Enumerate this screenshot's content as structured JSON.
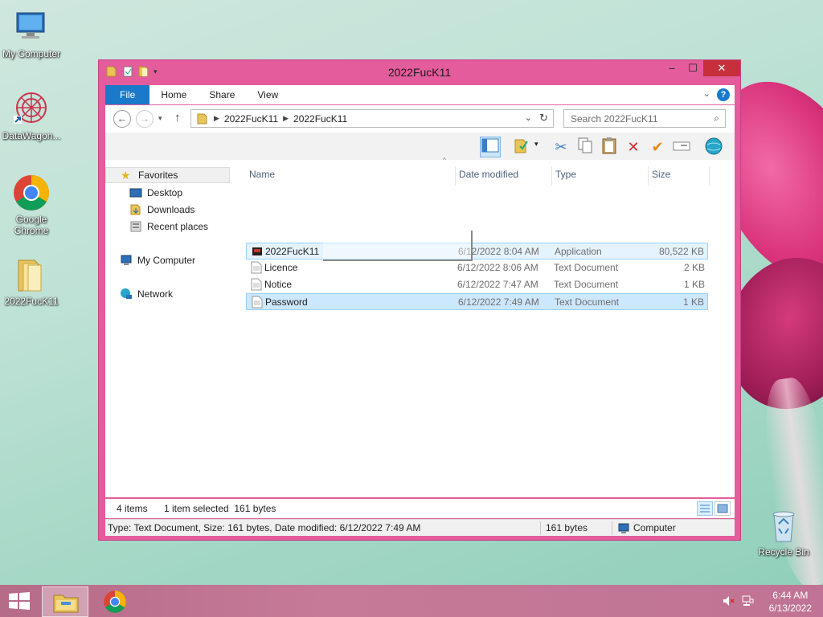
{
  "desktop": {
    "icons": [
      {
        "label": "My Computer",
        "icon": "my-computer-icon"
      },
      {
        "label": "DataWagon...",
        "icon": "datawagon-icon"
      },
      {
        "label": "Google Chrome",
        "icon": "chrome-icon"
      },
      {
        "label": "2022FucK11",
        "icon": "folder-icon"
      },
      {
        "label": "Recycle Bin",
        "icon": "recycle-bin-icon"
      }
    ]
  },
  "window": {
    "title": "2022FucK11",
    "controls": {
      "minimize": "–",
      "maximize": "☐",
      "close": "✕"
    },
    "ribbon_tabs": [
      "File",
      "Home",
      "Share",
      "View"
    ],
    "help": "?",
    "address": {
      "crumbs": [
        "2022FucK11",
        "2022FucK11"
      ]
    },
    "search": {
      "placeholder": "Search 2022FucK11"
    },
    "nav_pane": {
      "favorites": "Favorites",
      "items": [
        "Desktop",
        "Downloads",
        "Recent places"
      ],
      "computer": "My Computer",
      "network": "Network"
    },
    "columns": [
      "Name",
      "Date modified",
      "Type",
      "Size"
    ],
    "files": [
      {
        "name": "2022FucK11",
        "date": "6/12/2022 8:04 AM",
        "type": "Application",
        "size": "80,522 KB",
        "icon": "application-icon",
        "state": "hover"
      },
      {
        "name": "Licence",
        "date": "6/12/2022 8:06 AM",
        "type": "Text Document",
        "size": "2 KB",
        "icon": "text-file-icon",
        "state": "normal"
      },
      {
        "name": "Notice",
        "date": "6/12/2022 7:47 AM",
        "type": "Text Document",
        "size": "1 KB",
        "icon": "text-file-icon",
        "state": "normal"
      },
      {
        "name": "Password",
        "date": "6/12/2022 7:49 AM",
        "type": "Text Document",
        "size": "1 KB",
        "icon": "text-file-icon",
        "state": "selected"
      }
    ],
    "status": {
      "count": "4 items",
      "selection": "1 item selected  161 bytes"
    },
    "details_bar": {
      "info": "Type: Text Document, Size: 161 bytes, Date modified: 6/12/2022 7:49 AM",
      "size": "161 bytes",
      "location": "Computer"
    }
  },
  "taskbar": {
    "time": "6:44 AM",
    "date": "6/13/2022"
  },
  "colors": {
    "window_frame": "#e45c9c",
    "accent": "#1979ca",
    "selection": "#cce8ff",
    "taskbar": "#c07394"
  }
}
